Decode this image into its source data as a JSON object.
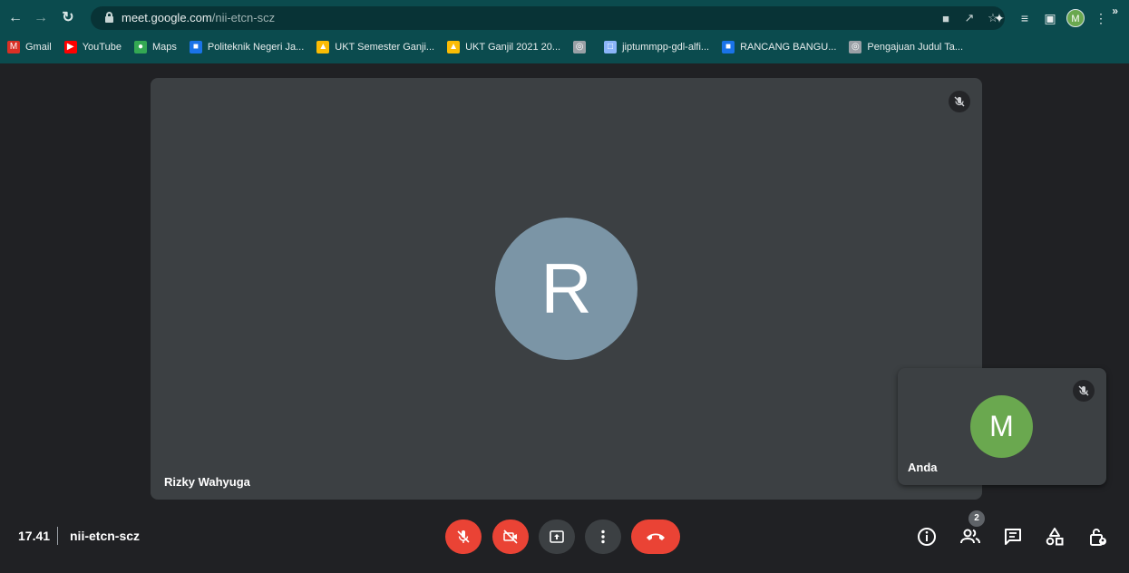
{
  "browser": {
    "url_host": "meet.google.com",
    "url_path": "/nii-etcn-scz",
    "profile_initial": "M",
    "bookmarks": [
      {
        "label": "Gmail",
        "icon": "gmail-icon",
        "color": "#d93025"
      },
      {
        "label": "YouTube",
        "icon": "youtube-icon",
        "color": "#ff0000"
      },
      {
        "label": "Maps",
        "icon": "maps-icon",
        "color": "#34a853"
      },
      {
        "label": "Politeknik Negeri Ja...",
        "icon": "site-icon",
        "color": "#1a73e8"
      },
      {
        "label": "UKT Semester Ganji...",
        "icon": "drive-icon",
        "color": "#fbbc04"
      },
      {
        "label": "UKT Ganjil 2021 20...",
        "icon": "drive-icon",
        "color": "#fbbc04"
      },
      {
        "label": "",
        "icon": "globe-icon",
        "color": "#9aa0a6"
      },
      {
        "label": "jiptummpp-gdl-alfi...",
        "icon": "doc-icon",
        "color": "#8ab4f8"
      },
      {
        "label": "RANCANG BANGU...",
        "icon": "site-icon",
        "color": "#1a73e8"
      },
      {
        "label": "Pengajuan Judul Ta...",
        "icon": "globe-icon",
        "color": "#9aa0a6"
      }
    ],
    "more_bookmarks": "»"
  },
  "meeting": {
    "main_participant": {
      "name": "Rizky Wahyuga",
      "initial": "R",
      "avatar_color": "#7b95a6",
      "muted": true
    },
    "self_participant": {
      "name": "Anda",
      "initial": "M",
      "avatar_color": "#6aa84f",
      "muted": true
    },
    "time": "17.41",
    "code": "nii-etcn-scz",
    "people_count": "2"
  },
  "controls": [
    {
      "name": "mic-off-button",
      "color": "#ea4335"
    },
    {
      "name": "camera-off-button",
      "color": "#ea4335"
    },
    {
      "name": "present-button",
      "color": "#3c4043"
    },
    {
      "name": "more-options-button",
      "color": "#3c4043"
    },
    {
      "name": "leave-call-button",
      "color": "#ea4335"
    }
  ]
}
